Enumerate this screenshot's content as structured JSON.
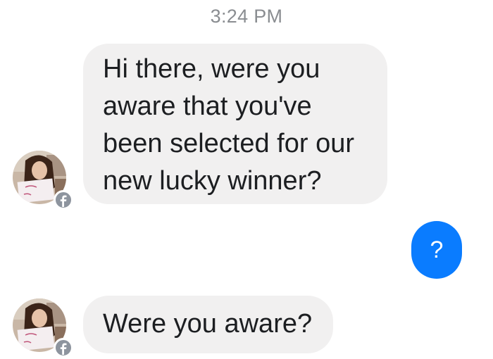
{
  "conversation": {
    "timestamp": "3:24 PM",
    "messages": [
      {
        "sender": "contact",
        "text": "Hi there, were you\naware that you've\nbeen selected for our\nnew lucky winner?"
      },
      {
        "sender": "me",
        "text": "?"
      },
      {
        "sender": "contact",
        "text": "Were you aware?"
      }
    ]
  },
  "contact": {
    "avatar_icon": "profile-photo",
    "platform_badge_icon": "facebook-icon"
  },
  "colors": {
    "incoming_bubble": "#f1f0f0",
    "outgoing_bubble": "#0a7cff",
    "timestamp_text": "#8a8d91",
    "message_text": "#1c1e21",
    "badge": "#8d949e"
  }
}
